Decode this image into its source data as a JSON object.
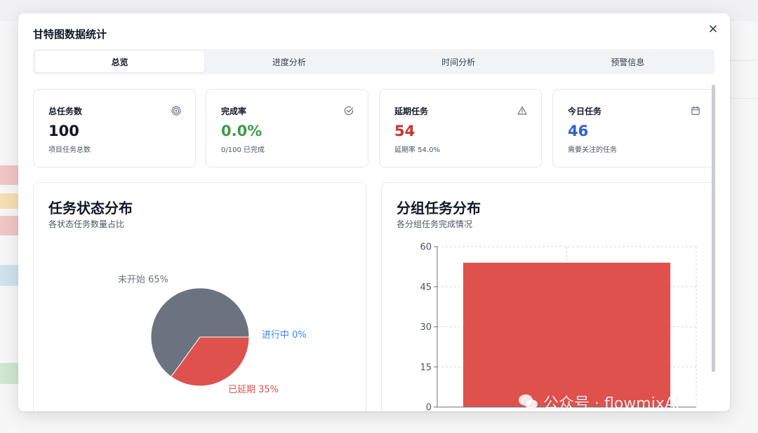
{
  "colors": {
    "green": "#3b9c4a",
    "red": "#c6362f",
    "blue": "#2f62cc",
    "pie_gray": "#6b7280",
    "pie_red": "#df514d",
    "pie_blue": "#3b82f6"
  },
  "dialog": {
    "title": "甘特图数据统计",
    "close_icon": "close-icon"
  },
  "tabs": [
    {
      "label": "总览",
      "active": true
    },
    {
      "label": "进度分析",
      "active": false
    },
    {
      "label": "时间分析",
      "active": false
    },
    {
      "label": "预警信息",
      "active": false
    }
  ],
  "stats": [
    {
      "label": "总任务数",
      "value": "100",
      "sub": "项目任务总数",
      "icon": "target-icon"
    },
    {
      "label": "完成率",
      "value": "0.0%",
      "sub": "0/100 已完成",
      "icon": "check-circle-icon"
    },
    {
      "label": "延期任务",
      "value": "54",
      "sub": "延期率 54.0%",
      "icon": "warning-icon"
    },
    {
      "label": "今日任务",
      "value": "46",
      "sub": "需要关注的任务",
      "icon": "calendar-icon"
    }
  ],
  "status_panel": {
    "title": "任务状态分布",
    "subtitle": "各状态任务数量占比"
  },
  "group_panel": {
    "title": "分组任务分布",
    "subtitle": "各分组任务完成情况"
  },
  "watermark": "公众号 · flowmixAI",
  "chart_data": [
    {
      "type": "pie",
      "slices": [
        {
          "label": "未开始 65%",
          "name": "未开始",
          "value": 65
        },
        {
          "label": "已延期 35%",
          "name": "已延期",
          "value": 35
        },
        {
          "label": "进行中 0%",
          "name": "进行中",
          "value": 0
        }
      ]
    },
    {
      "type": "bar",
      "categories": [
        ""
      ],
      "values": [
        54
      ],
      "ylim": [
        0,
        60
      ],
      "yticks": [
        0,
        15,
        30,
        45,
        60
      ],
      "grid": true
    }
  ]
}
